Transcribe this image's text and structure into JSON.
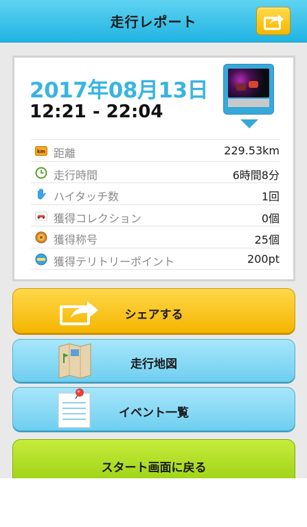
{
  "header": {
    "title": "走行レポート"
  },
  "report": {
    "date": "2017年08月13日",
    "time_range": "12:21 - 22:04"
  },
  "stats": [
    {
      "label": "距離",
      "value": "229.53km",
      "icon": "km-icon"
    },
    {
      "label": "走行時間",
      "value": "6時間8分",
      "icon": "clock-icon"
    },
    {
      "label": "ハイタッチ数",
      "value": "1回",
      "icon": "hand-icon"
    },
    {
      "label": "獲得コレクション",
      "value": "0個",
      "icon": "car-icon"
    },
    {
      "label": "獲得称号",
      "value": "25個",
      "icon": "medal-icon"
    },
    {
      "label": "獲得テリトリーポイント",
      "value": "200pt",
      "icon": "territory-icon"
    }
  ],
  "buttons": {
    "share": "シェアする",
    "map": "走行地図",
    "events": "イベント一覧",
    "back_to_start": "スタート画面に戻る"
  },
  "colors": {
    "header": "#20b4e2",
    "accent_date": "#39b4e0",
    "share_yellow": "#f4b800",
    "map_blue": "#6fcff0",
    "start_green": "#98cf12"
  }
}
